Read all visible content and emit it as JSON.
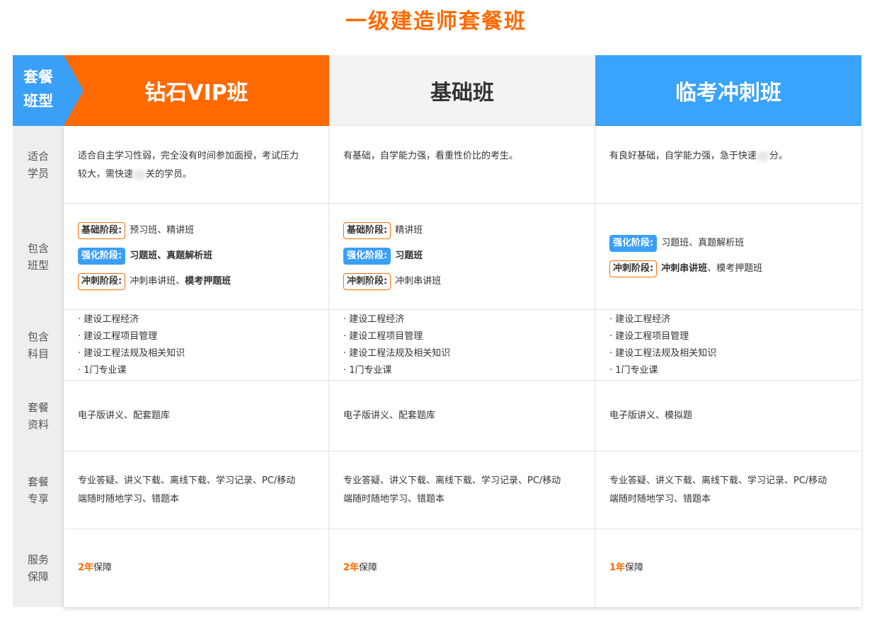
{
  "page_title": "一级建造师套餐班",
  "header": {
    "corner_line1": "套餐",
    "corner_line2": "班型",
    "vip": "钻石VIP班",
    "basic": "基础班",
    "sprint": "临考冲刺班"
  },
  "row_labels": {
    "r1a": "适合",
    "r1b": "学员",
    "r2a": "包含",
    "r2b": "班型",
    "r3a": "包含",
    "r3b": "科目",
    "r4a": "套餐",
    "r4b": "资料",
    "r5a": "套餐",
    "r5b": "专享",
    "r6a": "服务",
    "r6b": "保障"
  },
  "colors": {
    "orange": "#ff6a00",
    "blue": "#3a9ff7"
  },
  "vip": {
    "audience_1": "适合自主学习性弱，完全没有时间参加面授，考试压力",
    "audience_2a": "较大，需快速",
    "audience_2b": "关的学员。",
    "stages": {
      "s1_badge": "基础阶段:",
      "s1_text": "预习班、精讲班",
      "s2_badge": "强化阶段:",
      "s2_hl": "习题班、真题解析班",
      "s3_badge": "冲刺阶段:",
      "s3_text": "冲刺串讲班、",
      "s3_hl": "模考押题班"
    },
    "subjects": [
      "· 建设工程经济",
      "· 建设工程项目管理",
      "· 建设工程法规及相关知识",
      "· 1门专业课"
    ],
    "materials": "电子版讲义、配套题库",
    "exclusive_1": "专业答疑、讲义下载、离线下载、学习记录、PC/移动",
    "exclusive_2": "端随时随地学习、错题本",
    "guarantee_num": "2年",
    "guarantee_text": "保障"
  },
  "basic": {
    "audience": "有基础，自学能力强，看重性价比的考生。",
    "stages": {
      "s1_badge": "基础阶段:",
      "s1_text": "精讲班",
      "s2_badge": "强化阶段:",
      "s2_hl": "习题班",
      "s3_badge": "冲刺阶段:",
      "s3_text": "冲刺串讲班"
    },
    "subjects": [
      "· 建设工程经济",
      "· 建设工程项目管理",
      "· 建设工程法规及相关知识",
      "· 1门专业课"
    ],
    "materials": "电子版讲义、配套题库",
    "exclusive_1": "专业答疑、讲义下载、离线下载、学习记录、PC/移动",
    "exclusive_2": "端随时随地学习、错题本",
    "guarantee_num": "2年",
    "guarantee_text": "保障"
  },
  "sprint": {
    "audience_a": "有良好基础，自学能力强，急于快速",
    "audience_b": "分。",
    "stages": {
      "s1_badge": "强化阶段:",
      "s1_text": "习题班、真题解析班",
      "s2_badge": "冲刺阶段:",
      "s2_hl": "冲刺串讲班",
      "s2_sep": "、",
      "s2_text": "模考押题班"
    },
    "subjects": [
      "· 建设工程经济",
      "· 建设工程项目管理",
      "· 建设工程法规及相关知识",
      "· 1门专业课"
    ],
    "materials": "电子版讲义、模拟题",
    "exclusive_1": "专业答疑、讲义下载、离线下载、学习记录、PC/移动",
    "exclusive_2": "端随时随地学习、错题本",
    "guarantee_num": "1年",
    "guarantee_text": "保障"
  }
}
